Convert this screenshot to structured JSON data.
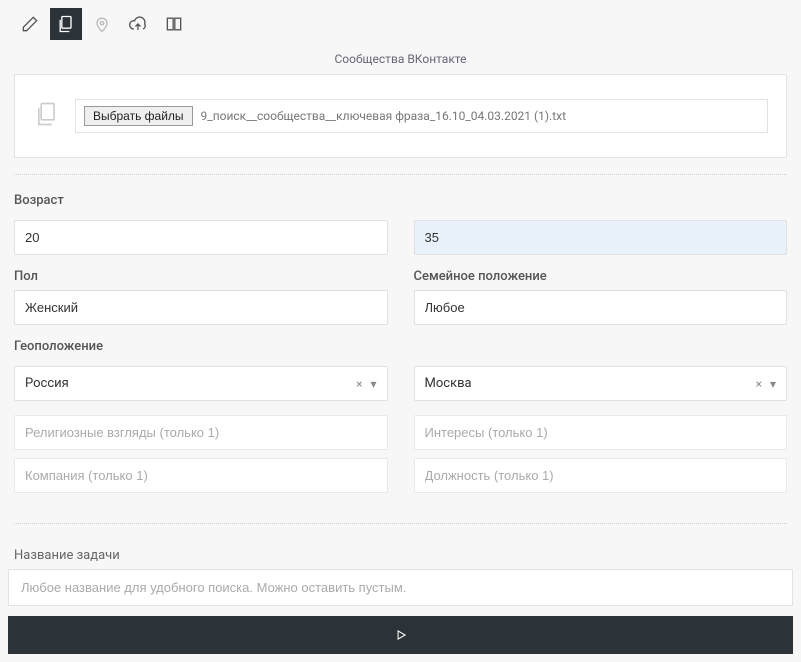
{
  "section_title": "Сообщества ВКонтакте",
  "upload": {
    "button_label": "Выбрать файлы",
    "file_name": "9_поиск__сообщества__ключевая фраза_16.10_04.03.2021 (1).txt"
  },
  "form": {
    "age_label": "Возраст",
    "age_from": "20",
    "age_to": "35",
    "gender_label": "Пол",
    "gender_value": "Женский",
    "marital_label": "Семейное положение",
    "marital_value": "Любое",
    "geo_label": "Геоположение",
    "country_value": "Россия",
    "city_value": "Москва",
    "religion_placeholder": "Религиозные взгляды (только 1)",
    "interests_placeholder": "Интересы (только 1)",
    "company_placeholder": "Компания (только 1)",
    "position_placeholder": "Должность (только 1)",
    "clear_x": "×",
    "caret": "▾"
  },
  "footer": {
    "task_label": "Название задачи",
    "task_placeholder": "Любое название для удобного поиска. Можно оставить пустым."
  }
}
